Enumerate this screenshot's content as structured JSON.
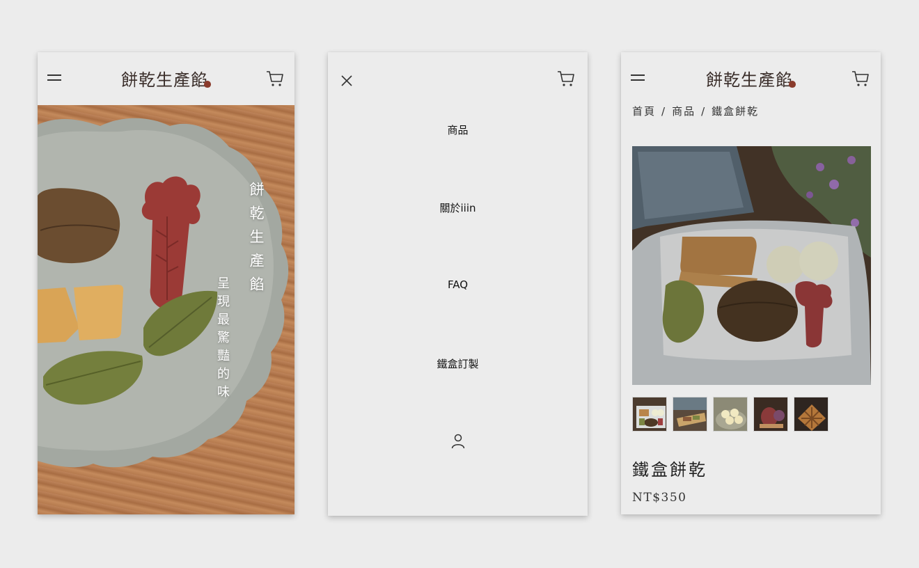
{
  "brand": {
    "logo_text": "餅乾生產餡"
  },
  "home": {
    "hero_title": "餅乾生產餡",
    "hero_subtitle": "呈現最驚豔的味"
  },
  "menu": {
    "items": [
      {
        "label": "商品"
      },
      {
        "label": "關於iiin"
      },
      {
        "label": "FAQ"
      },
      {
        "label": "鐵盒訂製"
      }
    ]
  },
  "product": {
    "breadcrumb": [
      "首頁",
      "商品",
      "鐵盒餅乾"
    ],
    "breadcrumb_separator": "/",
    "title": "鐵盒餅乾",
    "price": "NT$350",
    "thumbnail_count": 5
  },
  "colors": {
    "background": "#ececec",
    "logo_text": "#3a2e2a",
    "logo_accent": "#8a3b2c",
    "hero_text": "#ffffff"
  },
  "icons": [
    "hamburger-icon",
    "cart-icon",
    "close-icon",
    "user-icon",
    "chestnut-icon"
  ]
}
